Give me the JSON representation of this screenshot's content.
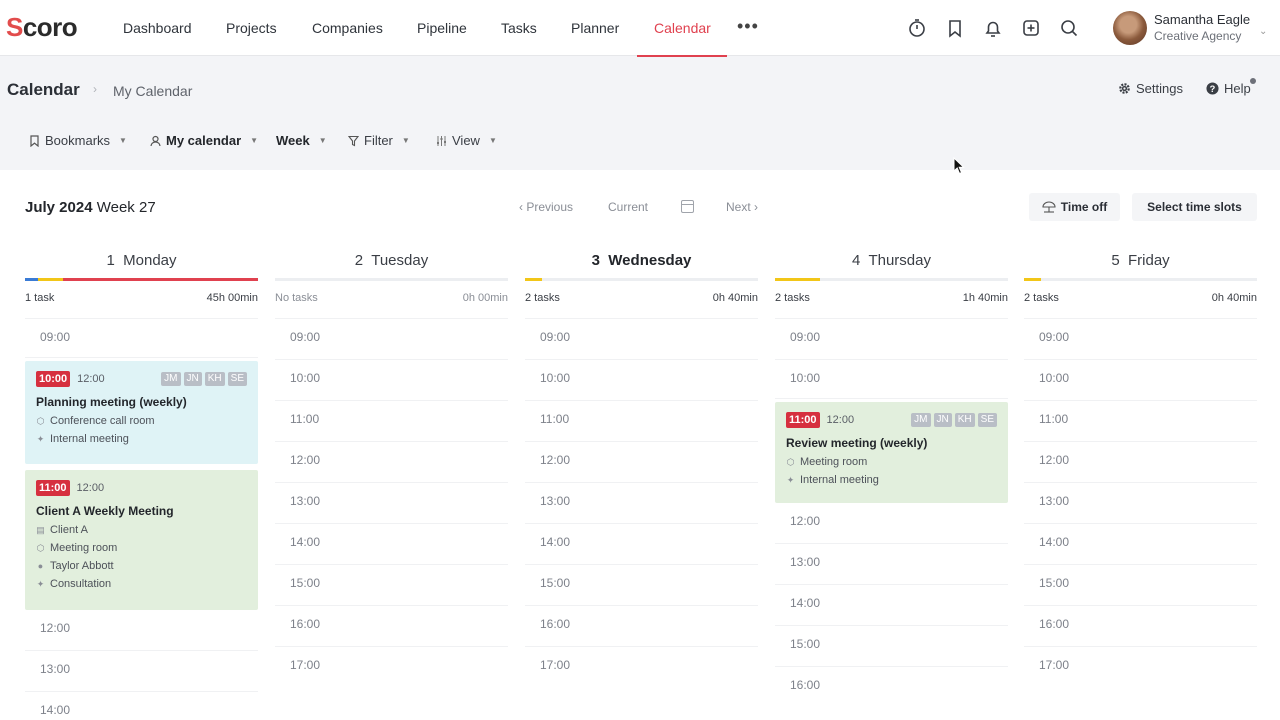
{
  "app": {
    "logo": "Scoro"
  },
  "nav": {
    "items": [
      {
        "label": "Dashboard"
      },
      {
        "label": "Projects"
      },
      {
        "label": "Companies"
      },
      {
        "label": "Pipeline"
      },
      {
        "label": "Tasks"
      },
      {
        "label": "Planner"
      },
      {
        "label": "Calendar"
      }
    ],
    "active": "Calendar",
    "icons": [
      "timer-icon",
      "bookmark-icon",
      "bell-icon",
      "add-icon",
      "search-icon"
    ]
  },
  "user": {
    "name": "Samantha Eagle",
    "org": "Creative Agency"
  },
  "header": {
    "title": "Calendar",
    "breadcrumb": "My Calendar",
    "settings": "Settings",
    "help": "Help"
  },
  "toolbar": {
    "bookmarks": "Bookmarks",
    "my_calendar": "My calendar",
    "week": "Week",
    "filter": "Filter",
    "view": "View"
  },
  "calendar": {
    "month": "July 2024",
    "week": "Week 27",
    "previous": "Previous",
    "current": "Current",
    "next": "Next",
    "time_off": "Time off",
    "select_slots": "Select time slots"
  },
  "days": [
    {
      "num": "1",
      "name": "Monday",
      "count": "1 task",
      "total": "45h 00min"
    },
    {
      "num": "2",
      "name": "Tuesday",
      "count": "No tasks",
      "total": "0h 00min"
    },
    {
      "num": "3",
      "name": "Wednesday",
      "count": "2 tasks",
      "total": "0h 40min"
    },
    {
      "num": "4",
      "name": "Thursday",
      "count": "2 tasks",
      "total": "1h 40min"
    },
    {
      "num": "5",
      "name": "Friday",
      "count": "2 tasks",
      "total": "0h 40min"
    }
  ],
  "hours": {
    "monday": [
      "09:00",
      "12:00",
      "13:00",
      "14:00"
    ],
    "tuesday": [
      "09:00",
      "10:00",
      "11:00",
      "12:00",
      "13:00",
      "14:00",
      "15:00",
      "16:00",
      "17:00"
    ],
    "wednesday": [
      "09:00",
      "10:00",
      "11:00",
      "12:00",
      "13:00",
      "14:00",
      "15:00",
      "16:00",
      "17:00"
    ],
    "thursday": [
      "09:00",
      "10:00",
      "12:00",
      "13:00",
      "14:00",
      "15:00",
      "16:00"
    ],
    "friday": [
      "09:00",
      "10:00",
      "11:00",
      "12:00",
      "13:00",
      "14:00",
      "15:00",
      "16:00",
      "17:00"
    ]
  },
  "events": {
    "planning": {
      "start": "10:00",
      "end": "12:00",
      "tags": [
        "JM",
        "JN",
        "KH",
        "SE"
      ],
      "title": "Planning meeting (weekly)",
      "room": "Conference call room",
      "type": "Internal meeting"
    },
    "client": {
      "start": "11:00",
      "end": "12:00",
      "title": "Client A Weekly Meeting",
      "client": "Client A",
      "room": "Meeting room",
      "person": "Taylor Abbott",
      "type": "Consultation"
    },
    "review": {
      "start": "11:00",
      "end": "12:00",
      "tags": [
        "JM",
        "JN",
        "KH",
        "SE"
      ],
      "title": "Review meeting (weekly)",
      "room": "Meeting room",
      "type": "Internal meeting"
    }
  },
  "colors": {
    "accent": "#e0414f",
    "event_blue": "#dff3f6",
    "event_green": "#e2efdd",
    "start_badge": "#d6303f"
  }
}
